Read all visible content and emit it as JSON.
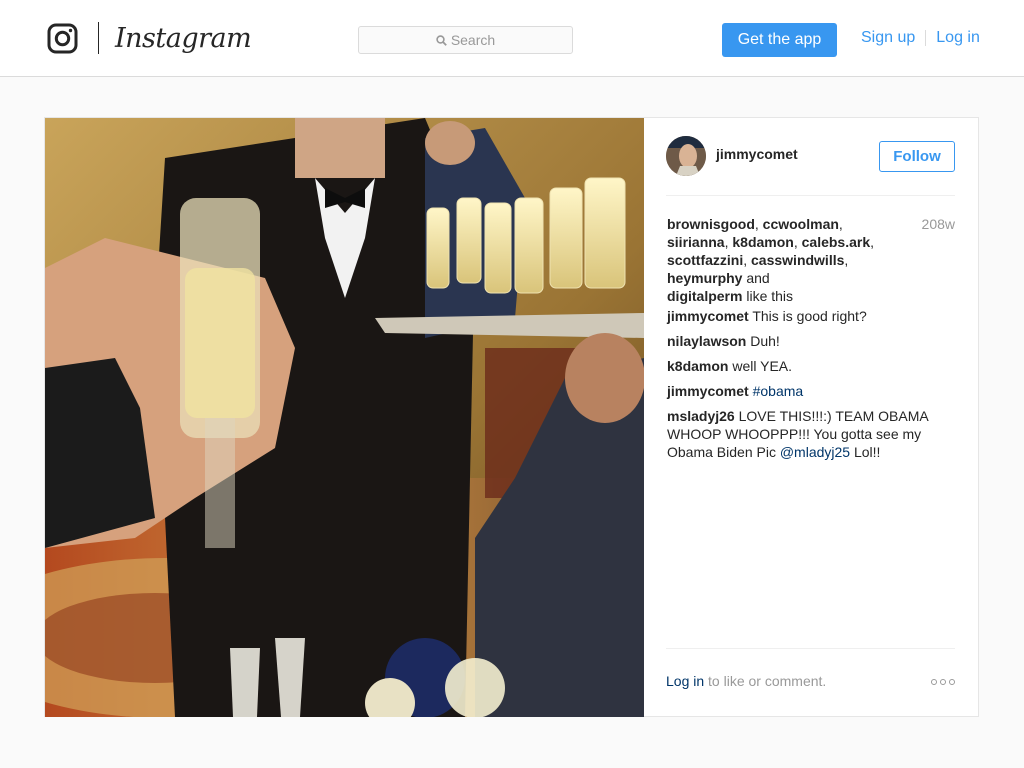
{
  "header": {
    "wordmark": "Instagram",
    "search_placeholder": "Search",
    "get_app_label": "Get the app",
    "signup_label": "Sign up",
    "login_label": "Log in"
  },
  "post": {
    "author": "jimmycomet",
    "follow_label": "Follow",
    "likes": {
      "users": [
        "brownisgood",
        "ccwoolman",
        "siirianna",
        "k8damon",
        "calebs.ark",
        "scottfazzini",
        "casswindwills",
        "heymurphy",
        "digitalperm"
      ],
      "sep": ", ",
      "and": "and",
      "suffix": "like this"
    },
    "time_ago": "208w",
    "comments": [
      {
        "user": "jimmycomet",
        "text": "This is good right?"
      },
      {
        "user": "nilaylawson",
        "text": "Duh!"
      },
      {
        "user": "k8damon",
        "text": "well YEA."
      },
      {
        "user": "jimmycomet",
        "tag": "#obama"
      },
      {
        "user": "msladyj26",
        "text": "LOVE THIS!!!:) TEAM OBAMA WHOOP WHOOPPP!!! You gotta see my Obama Biden Pic",
        "mention": "@mladyj25",
        "text_after": "Lol!!"
      }
    ],
    "footer": {
      "login_link": "Log in",
      "login_text": "to like or comment."
    }
  },
  "colors": {
    "accent": "#3897f0",
    "link_dark": "#003569",
    "muted": "#999999",
    "text": "#262626"
  },
  "icons": {
    "logo": "instagram-camera-icon",
    "search": "search-icon",
    "more": "more-options-icon"
  }
}
